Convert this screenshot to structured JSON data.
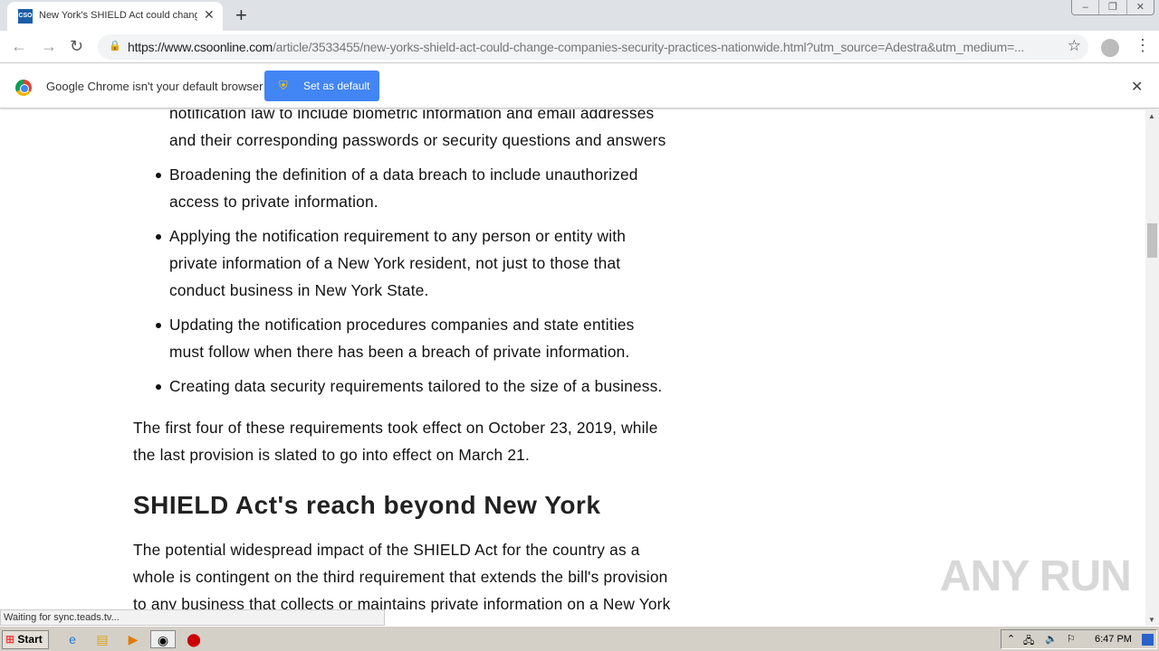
{
  "browser": {
    "tab_title": "New York's SHIELD Act could change companies security practices nationwide",
    "favicon_text": "CSO",
    "url_host": "https://www.csoonline.com",
    "url_path": "/article/3533455/new-yorks-shield-act-could-change-companies-security-practices-nationwide.html?utm_source=Adestra&utm_medium=...",
    "infobar_text": "Google Chrome isn't your default browser",
    "set_default_label": "Set as default",
    "status_text": "Waiting for sync.teads.tv..."
  },
  "article": {
    "bullet_tail": [
      "notification law to include biometric information and email addresses",
      "and their corresponding passwords or security questions and answers"
    ],
    "bullets": [
      [
        "Broadening the definition of a data breach to include unauthorized",
        "access to private information."
      ],
      [
        "Applying the notification requirement to any person or entity with",
        "private information of a New York resident, not just to those that",
        "conduct business in New York State."
      ],
      [
        "Updating the notification procedures companies and state entities",
        "must follow when there has been a breach of private information."
      ],
      [
        "Creating data security requirements tailored to the size of a business."
      ]
    ],
    "para1": [
      "The first four of these requirements took effect on October 23, 2019, while",
      "the last provision is slated to go into effect on March 21."
    ],
    "heading": "SHIELD Act's reach beyond New York",
    "para2": [
      "The potential widespread impact of the SHIELD Act for the country as a",
      "whole is contingent on the third requirement that extends the bill's provision",
      "to any business that collects or maintains private information on a New York"
    ]
  },
  "watermark": "ANY RUN",
  "taskbar": {
    "start_label": "Start",
    "clock": "6:47 PM"
  },
  "colors": {
    "accent": "#4285f4",
    "tabbar": "#dee1e6",
    "taskbar": "#d4d0c8"
  }
}
